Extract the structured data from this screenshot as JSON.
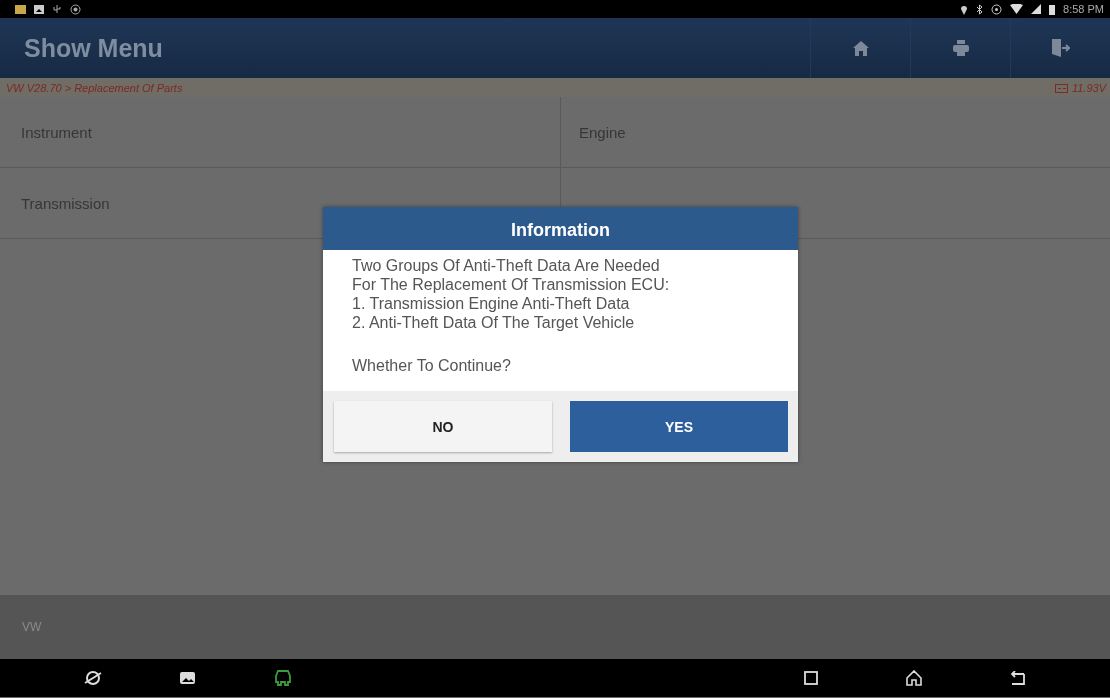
{
  "status_bar": {
    "time": "8:58 PM"
  },
  "header": {
    "title": "Show Menu"
  },
  "info_bar": {
    "breadcrumb": "VW V28.70 > Replacement Of Parts",
    "voltage": "11.93V"
  },
  "menu_items": [
    {
      "label": "Instrument"
    },
    {
      "label": "Engine"
    },
    {
      "label": "Transmission"
    }
  ],
  "footer": {
    "label": "VW"
  },
  "dialog": {
    "title": "Information",
    "message_lines": [
      "Two Groups Of Anti-Theft Data Are Needed",
      "For The Replacement Of Transmission ECU:",
      "1. Transmission Engine Anti-Theft Data",
      "2. Anti-Theft Data Of The Target Vehicle"
    ],
    "question": "Whether To Continue?",
    "buttons": [
      {
        "label": "NO",
        "kind": "secondary"
      },
      {
        "label": "YES",
        "kind": "primary"
      }
    ]
  }
}
